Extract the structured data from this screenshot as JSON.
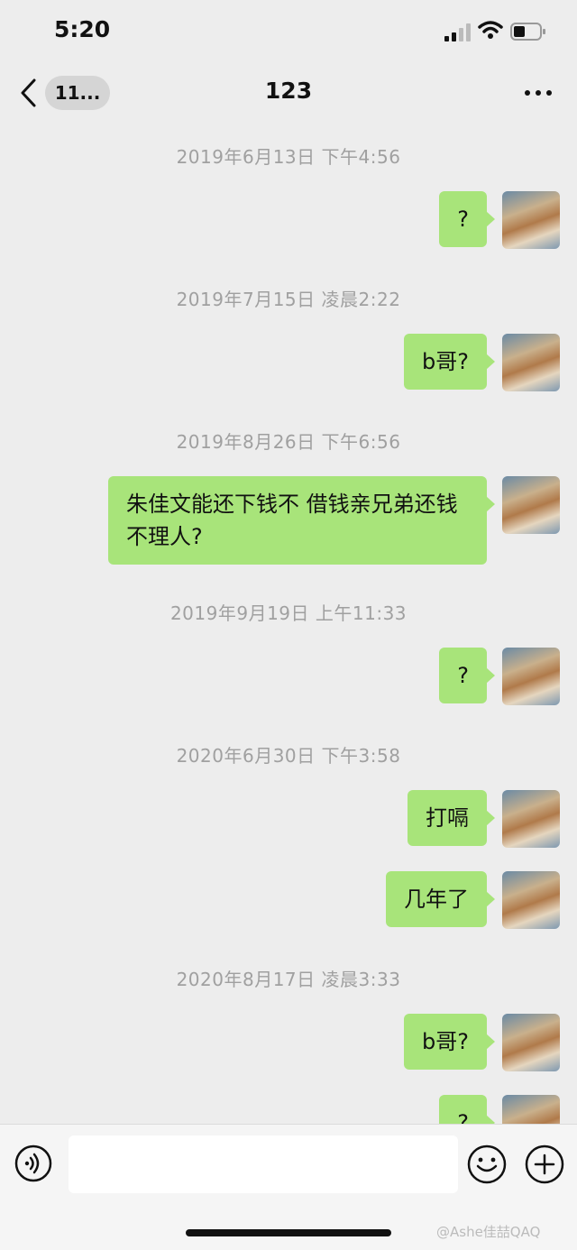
{
  "status": {
    "time": "5:20"
  },
  "nav": {
    "back_count": "11...",
    "title": "123"
  },
  "messages": [
    {
      "timestamp": "2019年6月13日 下午4:56",
      "texts": [
        "?"
      ]
    },
    {
      "timestamp": "2019年7月15日 凌晨2:22",
      "texts": [
        "b哥?"
      ]
    },
    {
      "timestamp": "2019年8月26日 下午6:56",
      "texts": [
        "朱佳文能还下钱不 借钱亲兄弟还钱不理人?"
      ]
    },
    {
      "timestamp": "2019年9月19日 上午11:33",
      "texts": [
        "?"
      ]
    },
    {
      "timestamp": "2020年6月30日 下午3:58",
      "texts": [
        "打嗝",
        "几年了"
      ]
    },
    {
      "timestamp": "2020年8月17日 凌晨3:33",
      "texts": [
        "b哥?",
        "?"
      ]
    }
  ],
  "icons": {
    "back": "chevron-left-icon",
    "more": "more-dots-icon",
    "voice": "voice-icon",
    "emoji": "emoji-icon",
    "plus": "plus-icon"
  },
  "colors": {
    "bubble": "#a8e47a",
    "background": "#ededed"
  },
  "watermark": "@Ashe佳喆QAQ"
}
